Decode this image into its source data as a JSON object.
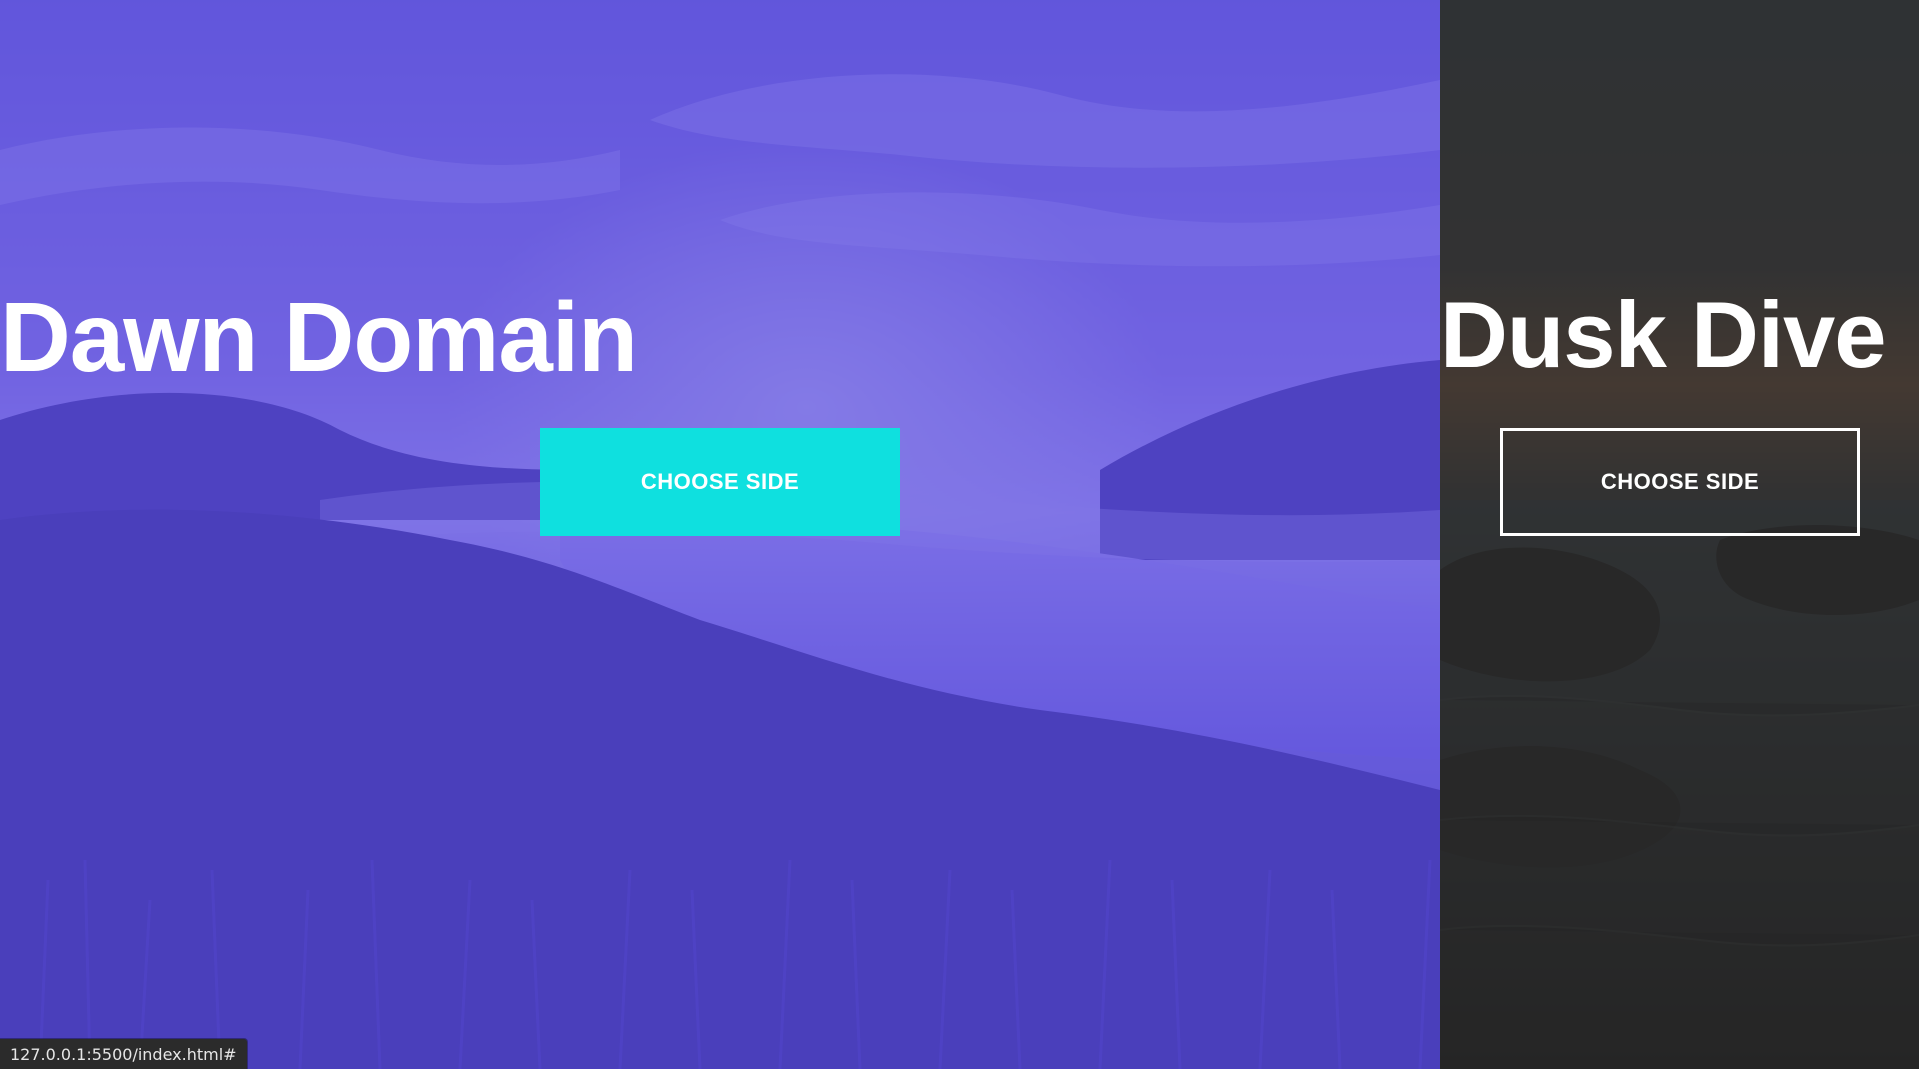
{
  "left_panel": {
    "title": "Dawn Domain",
    "button_label": "Choose Side",
    "overlay_color": "#5649dc",
    "button_color": "#0fe0df"
  },
  "right_panel": {
    "title": "Dusk Dive",
    "button_label": "Choose Side",
    "overlay_color": "#2b2b2b",
    "button_border_color": "#ffffff"
  },
  "status_bar": {
    "url": "127.0.0.1:5500/index.html#"
  }
}
